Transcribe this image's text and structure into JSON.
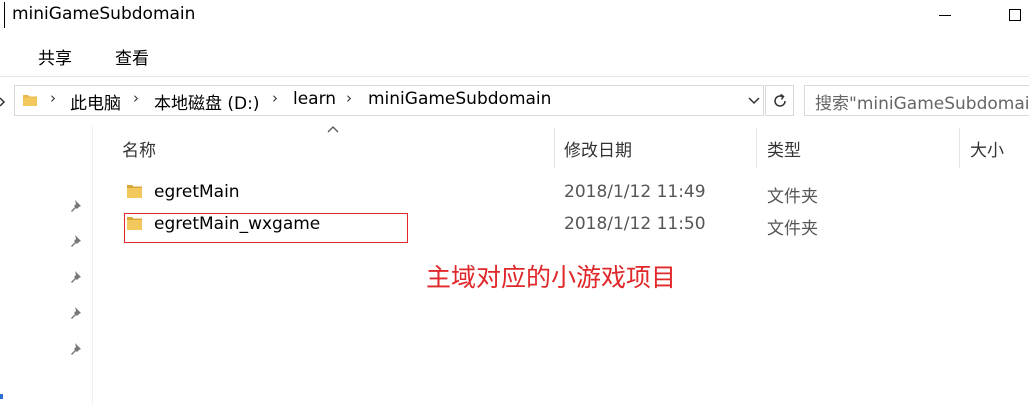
{
  "window": {
    "title": "miniGameSubdomain"
  },
  "ribbon": {
    "tabs": [
      "共享",
      "查看"
    ]
  },
  "address": {
    "crumbs": [
      "此电脑",
      "本地磁盘 (D:)",
      "learn",
      "miniGameSubdomain"
    ],
    "separator": "›"
  },
  "search": {
    "placeholder": "搜索\"miniGameSubdomain\""
  },
  "columns": {
    "name": "名称",
    "date": "修改日期",
    "type": "类型",
    "size": "大小"
  },
  "files": [
    {
      "name": "egretMain",
      "date": "2018/1/12 11:49",
      "type": "文件夹"
    },
    {
      "name": "egretMain_wxgame",
      "date": "2018/1/12 11:50",
      "type": "文件夹"
    }
  ],
  "annotation": {
    "text": "主域对应的小游戏项目",
    "color": "#e0282a"
  },
  "colors": {
    "folder": "#e8b84a",
    "folder_dark": "#d9a43a"
  }
}
